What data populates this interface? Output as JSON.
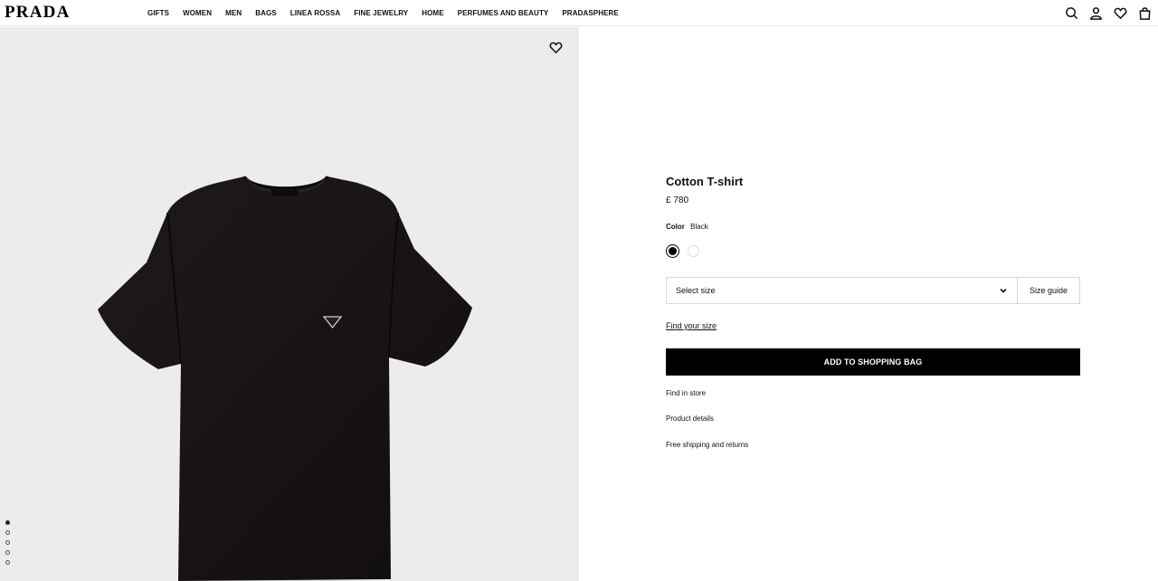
{
  "brand": {
    "logo": "PRADA"
  },
  "nav": {
    "items": [
      "GIFTS",
      "WOMEN",
      "MEN",
      "BAGS",
      "LINEA ROSSA",
      "FINE JEWELRY",
      "HOME",
      "PERFUMES AND BEAUTY",
      "PRADASPHERE"
    ]
  },
  "header_icons": [
    "search-icon",
    "account-icon",
    "wishlist-icon",
    "bag-icon"
  ],
  "gallery": {
    "image": "black-tshirt-image",
    "pages": 5,
    "active_page": 1
  },
  "product": {
    "title": "Cotton T-shirt",
    "price": "£ 780",
    "color_label": "Color",
    "color_value": "Black",
    "swatches": [
      "#000000",
      "#ffffff"
    ],
    "size_placeholder": "Select size",
    "size_guide": "Size guide",
    "find_size": "Find your size",
    "add_to_bag": "ADD TO SHOPPING BAG",
    "links": [
      "Find in store",
      "Product details",
      "Free shipping and returns"
    ]
  }
}
